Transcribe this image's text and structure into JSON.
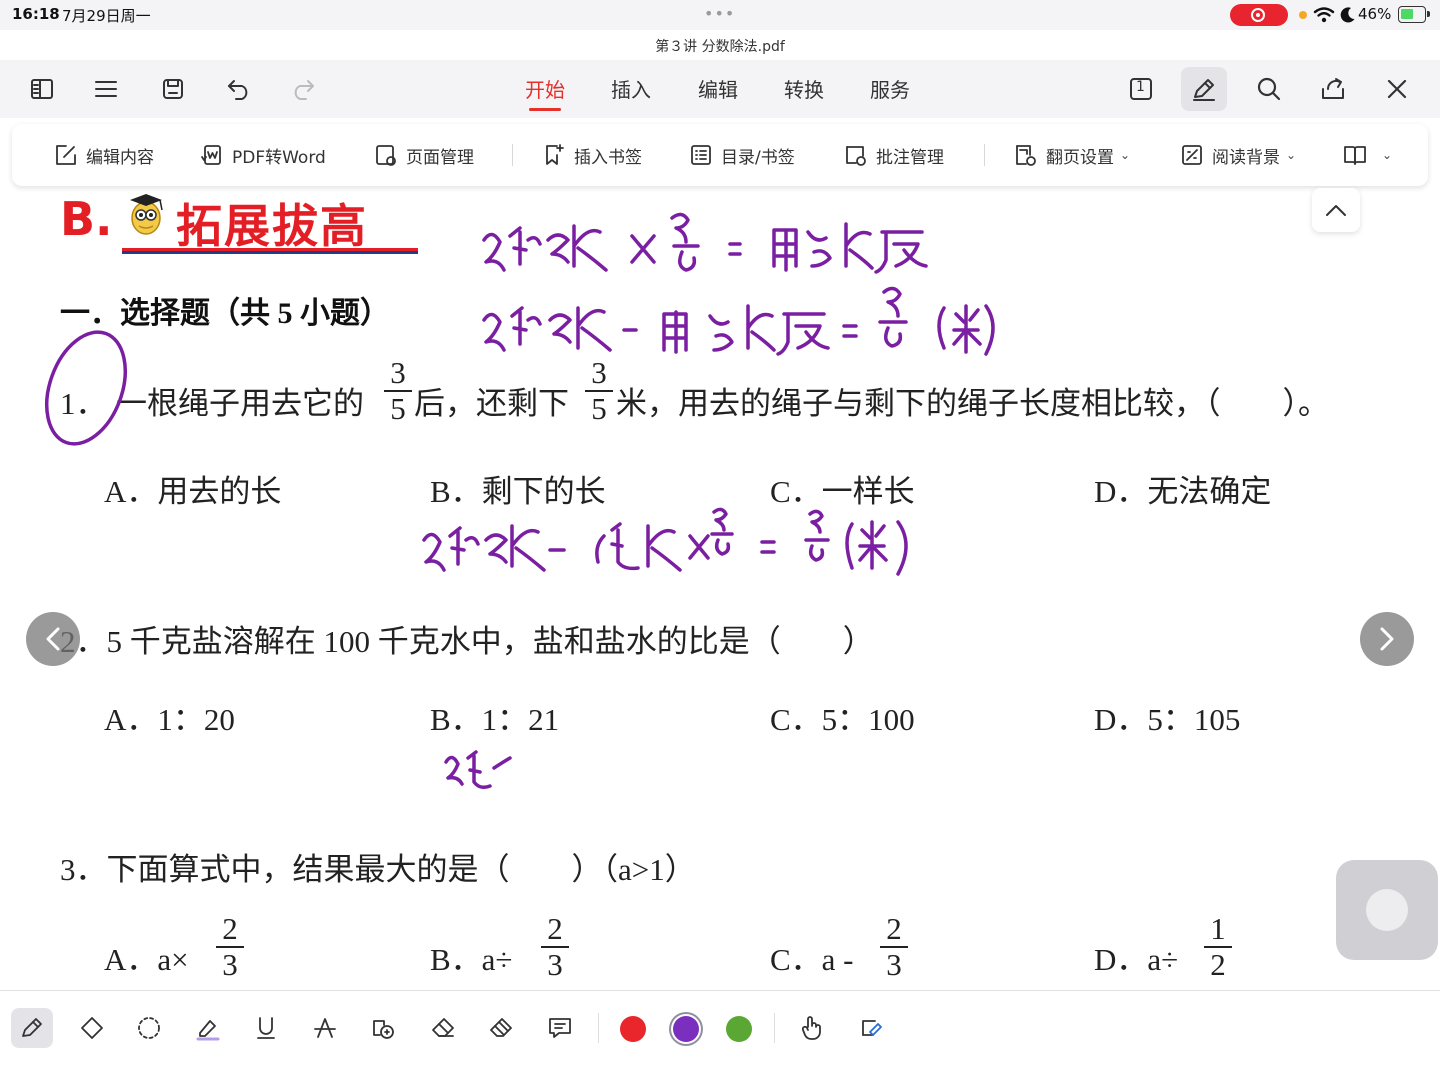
{
  "status_bar": {
    "time": "16:18",
    "date": "7月29日周一",
    "battery": "46%"
  },
  "document": {
    "title": "第３讲 分数除法.pdf"
  },
  "menu_tabs": [
    "开始",
    "插入",
    "编辑",
    "转换",
    "服务"
  ],
  "page_indicator": "1",
  "ribbon": {
    "edit_content": "编辑内容",
    "pdf_to_word": "PDF转Word",
    "page_manage": "页面管理",
    "insert_bookmark": "插入书签",
    "toc_bookmark": "目录/书签",
    "annotation_manage": "批注管理",
    "page_turn_settings": "翻页设置",
    "reading_background": "阅读背景"
  },
  "content": {
    "section_letter": "B.",
    "section_title": "拓展拔高",
    "part_title": "一．选择题（共 5 小题）",
    "q1": {
      "num": "1．",
      "text_a": "一根绳子用去它的",
      "frac_a": {
        "num": "3",
        "den": "5"
      },
      "text_b": "后，还剩下",
      "frac_b": {
        "num": "3",
        "den": "5"
      },
      "text_c": "米，用去的绳子与剩下的绳子长度相比较，（　　）。",
      "options": [
        "A．用去的长",
        "B．剩下的长",
        "C．一样长",
        "D．无法确定"
      ]
    },
    "q2": {
      "text": "2．5 千克盐溶解在 100 千克水中，盐和盐水的比是（　　）",
      "options": [
        "A．1：20",
        "B．1：21",
        "C．5：100",
        "D．5：105"
      ]
    },
    "q3": {
      "text": "3．下面算式中，结果最大的是（　　）（a>1）",
      "options": [
        {
          "label": "A．a×",
          "num": "2",
          "den": "3"
        },
        {
          "label": "B．a÷",
          "num": "2",
          "den": "3"
        },
        {
          "label": "C．a -",
          "num": "2",
          "den": "3"
        },
        {
          "label": "D．a÷",
          "num": "1",
          "den": "2"
        }
      ]
    }
  },
  "colors": {
    "accent": "#e5302b",
    "ink_purple": "#7a1fa2",
    "swatch_red": "#e8262c",
    "swatch_purple": "#7b2fbf",
    "swatch_green": "#5aa833"
  },
  "icons": {
    "top_left": [
      "sidebar-icon",
      "menu-icon",
      "save-icon",
      "undo-icon",
      "redo-icon"
    ],
    "top_right": [
      "page-number-icon",
      "pen-icon",
      "search-icon",
      "share-icon",
      "close-icon"
    ],
    "pen_tools": [
      "pen-tool-icon",
      "eraser-shape-icon",
      "lasso-icon",
      "highlighter-icon",
      "underline-icon",
      "strikethrough-icon",
      "text-box-icon",
      "eraser-icon",
      "clear-icon",
      "comment-icon",
      "hand-icon",
      "edit-shape-icon"
    ]
  }
}
